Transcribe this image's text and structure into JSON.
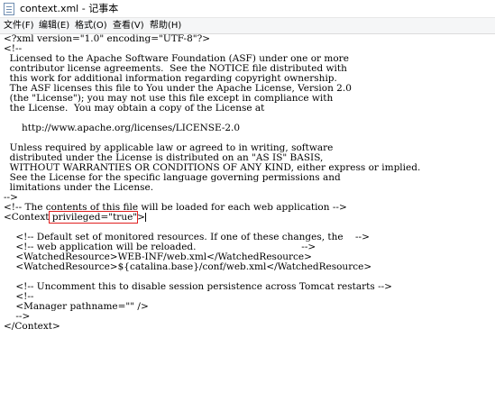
{
  "window": {
    "title": "context.xml - 记事本"
  },
  "menu": [
    "文件(F)",
    "编辑(E)",
    "格式(O)",
    "查看(V)",
    "帮助(H)"
  ],
  "editor": {
    "lines": [
      "<?xml version=\"1.0\" encoding=\"UTF-8\"?>",
      "<!--",
      "  Licensed to the Apache Software Foundation (ASF) under one or more",
      "  contributor license agreements.  See the NOTICE file distributed with",
      "  this work for additional information regarding copyright ownership.",
      "  The ASF licenses this file to You under the Apache License, Version 2.0",
      "  (the \"License\"); you may not use this file except in compliance with",
      "  the License.  You may obtain a copy of the License at",
      "",
      "      http://www.apache.org/licenses/LICENSE-2.0",
      "",
      "  Unless required by applicable law or agreed to in writing, software",
      "  distributed under the License is distributed on an \"AS IS\" BASIS,",
      "  WITHOUT WARRANTIES OR CONDITIONS OF ANY KIND, either express or implied.",
      "  See the License for the specific language governing permissions and",
      "  limitations under the License.",
      "-->",
      "<!-- The contents of this file will be loaded for each web application -->",
      "<Context privileged=\"true\">",
      "",
      "    <!-- Default set of monitored resources. If one of these changes, the    -->",
      "    <!-- web application will be reloaded.                                   -->",
      "    <WatchedResource>WEB-INF/web.xml</WatchedResource>",
      "    <WatchedResource>${catalina.base}/conf/web.xml</WatchedResource>",
      "",
      "    <!-- Uncomment this to disable session persistence across Tomcat restarts -->",
      "    <!--",
      "    <Manager pathname=\"\" />",
      "    -->",
      "</Context>"
    ],
    "context_tag_open": "<Context",
    "context_attr": " privileged=\"true\"",
    "context_tag_close": ">"
  },
  "colors": {
    "highlight_box": "#e02020"
  }
}
